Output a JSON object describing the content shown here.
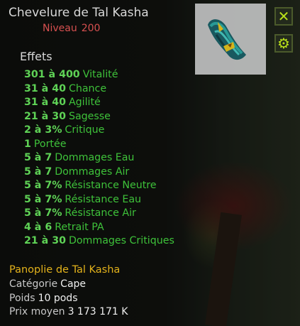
{
  "item": {
    "name": "Chevelure de Tal Kasha",
    "level_label": "Niveau",
    "level_value": "200",
    "icon_name": "blue-hair-cape-icon"
  },
  "effects_title": "Effets",
  "effects": [
    {
      "value": "301 à 400",
      "stat": "Vitalité"
    },
    {
      "value": "31 à 40",
      "stat": "Chance"
    },
    {
      "value": "31 à 40",
      "stat": "Agilité"
    },
    {
      "value": "21 à 30",
      "stat": "Sagesse"
    },
    {
      "value": "2 à 3%",
      "stat": "Critique"
    },
    {
      "value": "1",
      "stat": "Portée"
    },
    {
      "value": "5 à 7",
      "stat": "Dommages Eau"
    },
    {
      "value": "5 à 7",
      "stat": "Dommages Air"
    },
    {
      "value": "5 à 7%",
      "stat": "Résistance Neutre"
    },
    {
      "value": "5 à 7%",
      "stat": "Résistance Eau"
    },
    {
      "value": "5 à 7%",
      "stat": "Résistance Air"
    },
    {
      "value": "4 à 6",
      "stat": "Retrait PA"
    },
    {
      "value": "21 à 30",
      "stat": "Dommages Critiques"
    }
  ],
  "set_name": "Panoplie de Tal Kasha",
  "category": {
    "label": "Catégorie",
    "value": "Cape"
  },
  "weight": {
    "label": "Poids",
    "value": "10 pods"
  },
  "avg_price": {
    "label": "Prix moyen",
    "value": "3 173 171 K"
  },
  "buttons": {
    "close_icon": "close-icon",
    "settings_icon": "gear-icon"
  },
  "colors": {
    "effect_green": "#3ec23a",
    "set_gold": "#e3b21b",
    "level_red": "#d75050",
    "button_lime": "#b9e01a"
  }
}
